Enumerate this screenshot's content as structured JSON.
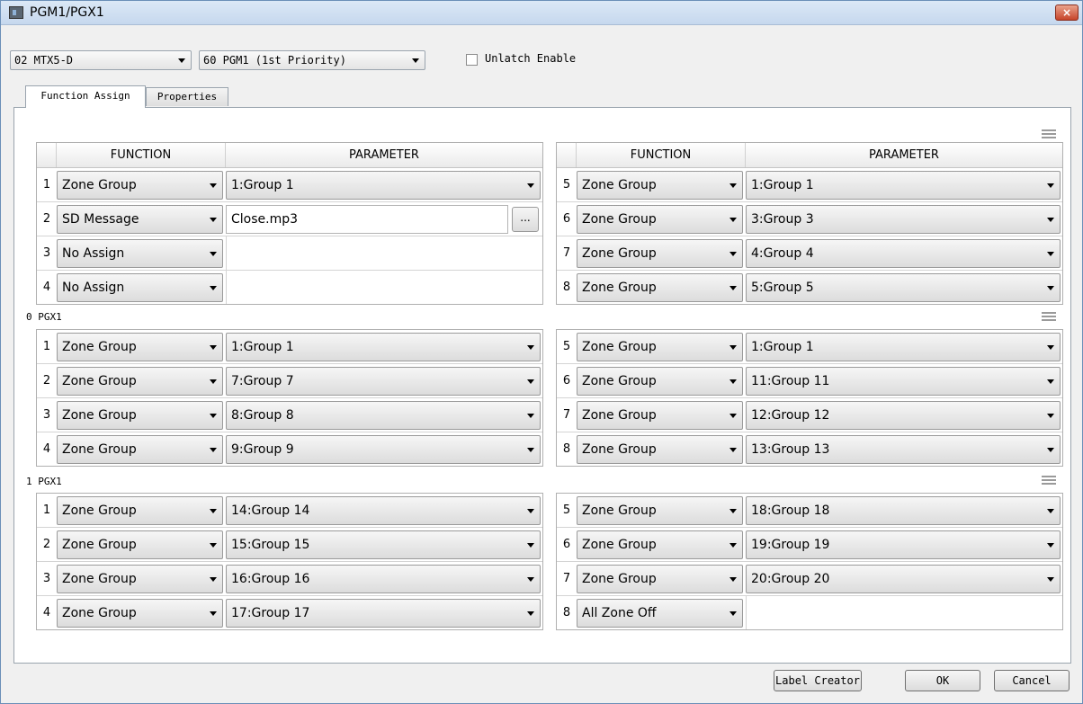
{
  "window": {
    "title": "PGM1/PGX1"
  },
  "header": {
    "device_select": "02 MTX5-D",
    "port_select": "60 PGM1 (1st Priority)",
    "unlatch_label": "Unlatch Enable"
  },
  "tabs": [
    {
      "label": "Function Assign",
      "active": true
    },
    {
      "label": "Properties",
      "active": false
    }
  ],
  "columns": {
    "function": "FUNCTION",
    "parameter": "PARAMETER"
  },
  "sections": [
    {
      "label": "",
      "left": [
        {
          "num": "1",
          "function": "Zone Group",
          "param": "1:Group 1",
          "param_type": "select"
        },
        {
          "num": "2",
          "function": "SD Message",
          "param": "Close.mp3",
          "param_type": "file",
          "browse": "..."
        },
        {
          "num": "3",
          "function": "No Assign",
          "param": "",
          "param_type": "empty"
        },
        {
          "num": "4",
          "function": "No Assign",
          "param": "",
          "param_type": "empty"
        }
      ],
      "right": [
        {
          "num": "5",
          "function": "Zone Group",
          "param": "1:Group 1",
          "param_type": "select"
        },
        {
          "num": "6",
          "function": "Zone Group",
          "param": "3:Group 3",
          "param_type": "select"
        },
        {
          "num": "7",
          "function": "Zone Group",
          "param": "4:Group 4",
          "param_type": "select"
        },
        {
          "num": "8",
          "function": "Zone Group",
          "param": "5:Group 5",
          "param_type": "select"
        }
      ]
    },
    {
      "label": "0 PGX1",
      "left": [
        {
          "num": "1",
          "function": "Zone Group",
          "param": "1:Group 1",
          "param_type": "select"
        },
        {
          "num": "2",
          "function": "Zone Group",
          "param": "7:Group 7",
          "param_type": "select"
        },
        {
          "num": "3",
          "function": "Zone Group",
          "param": "8:Group 8",
          "param_type": "select"
        },
        {
          "num": "4",
          "function": "Zone Group",
          "param": "9:Group 9",
          "param_type": "select"
        }
      ],
      "right": [
        {
          "num": "5",
          "function": "Zone Group",
          "param": "1:Group 1",
          "param_type": "select"
        },
        {
          "num": "6",
          "function": "Zone Group",
          "param": "11:Group 11",
          "param_type": "select"
        },
        {
          "num": "7",
          "function": "Zone Group",
          "param": "12:Group 12",
          "param_type": "select"
        },
        {
          "num": "8",
          "function": "Zone Group",
          "param": "13:Group 13",
          "param_type": "select"
        }
      ]
    },
    {
      "label": "1 PGX1",
      "left": [
        {
          "num": "1",
          "function": "Zone Group",
          "param": "14:Group 14",
          "param_type": "select"
        },
        {
          "num": "2",
          "function": "Zone Group",
          "param": "15:Group 15",
          "param_type": "select"
        },
        {
          "num": "3",
          "function": "Zone Group",
          "param": "16:Group 16",
          "param_type": "select"
        },
        {
          "num": "4",
          "function": "Zone Group",
          "param": "17:Group 17",
          "param_type": "select"
        }
      ],
      "right": [
        {
          "num": "5",
          "function": "Zone Group",
          "param": "18:Group 18",
          "param_type": "select"
        },
        {
          "num": "6",
          "function": "Zone Group",
          "param": "19:Group 19",
          "param_type": "select"
        },
        {
          "num": "7",
          "function": "Zone Group",
          "param": "20:Group 20",
          "param_type": "select"
        },
        {
          "num": "8",
          "function": "All Zone Off",
          "param": "",
          "param_type": "empty"
        }
      ]
    }
  ],
  "footer": {
    "label_creator": "Label Creator",
    "ok": "OK",
    "cancel": "Cancel"
  }
}
